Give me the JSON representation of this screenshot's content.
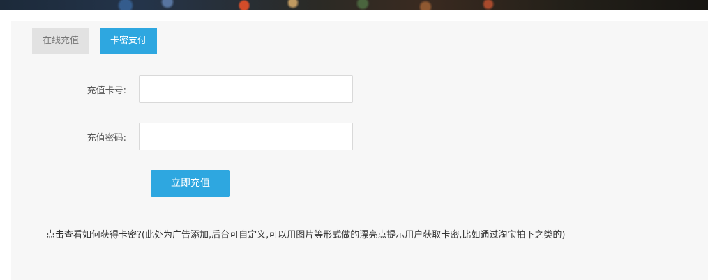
{
  "tabs": [
    {
      "label": "在线充值",
      "active": false
    },
    {
      "label": "卡密支付",
      "active": true
    }
  ],
  "form": {
    "card_number_label": "充值卡号:",
    "card_number_value": "",
    "card_password_label": "充值密码:",
    "card_password_value": "",
    "submit_label": "立即充值"
  },
  "ad_note": "点击查看如何获得卡密?(此处为广告添加,后台可自定义,可以用图片等形式做的漂亮点提示用户获取卡密,比如通过淘宝拍下之类的)",
  "colors": {
    "accent": "#2ea7e0",
    "tab_inactive_bg": "#e2e2e2",
    "panel_bg": "#f7f7f7"
  }
}
